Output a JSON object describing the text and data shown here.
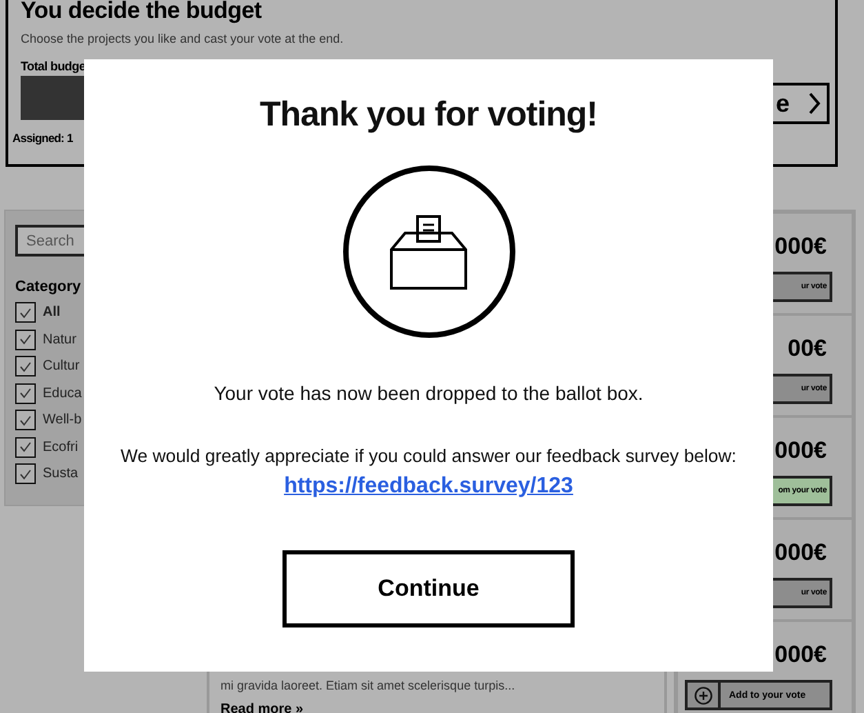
{
  "header": {
    "title": "You decide the budget",
    "subtitle": "Choose the projects you like and cast your vote at the end.",
    "total_label": "Total budge",
    "assigned": "Assigned: 1",
    "next_button": "e"
  },
  "sidebar": {
    "search_placeholder": "Search",
    "category_title": "Category",
    "categories": [
      {
        "label": "All",
        "kind": "all",
        "checked": true
      },
      {
        "label": "Natur",
        "kind": "category",
        "checked": true
      },
      {
        "label": "Cultur",
        "kind": "category",
        "checked": true
      },
      {
        "label": "Educa",
        "kind": "category",
        "checked": true
      },
      {
        "label": "Well-b",
        "kind": "category",
        "checked": true
      },
      {
        "label": "Ecofri",
        "kind": "category",
        "checked": true
      },
      {
        "label": "Susta",
        "kind": "category",
        "checked": true
      }
    ]
  },
  "projects": [
    {
      "price": "000€",
      "button": {
        "label": "ur vote",
        "in_vote": false,
        "has_icon": false
      }
    },
    {
      "price": "00€",
      "button": {
        "label": "ur vote",
        "in_vote": false,
        "has_icon": false
      }
    },
    {
      "price": "000€",
      "button": {
        "label": "om your vote",
        "in_vote": true,
        "has_icon": false
      }
    },
    {
      "price": "000€",
      "button": {
        "label": "ur vote",
        "in_vote": false,
        "has_icon": false
      }
    },
    {
      "price": "000€",
      "button": {
        "label": "Add to your vote",
        "in_vote": false,
        "has_icon": true
      }
    }
  ],
  "excerpt": {
    "text": "mi gravida laoreet. Etiam sit amet scelerisque turpis...",
    "read_more": "Read more »"
  },
  "modal": {
    "title": "Thank you for voting!",
    "message": "Your vote has now been dropped to the ballot box.",
    "request": "We would greatly appreciate if you could answer our feedback survey below:",
    "link": "https://feedback.survey/123",
    "button": "Continue"
  }
}
